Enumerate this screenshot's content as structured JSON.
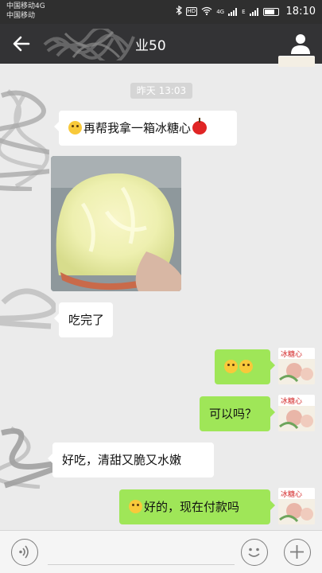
{
  "status_bar": {
    "carrier_line1": "中国移动4G",
    "carrier_line2": "中国移动",
    "network_1": "4G",
    "network_2": "E",
    "time": "18:10"
  },
  "header": {
    "title_suffix": "业50"
  },
  "chat": {
    "timestamp": "昨天 13:03",
    "messages": [
      {
        "side": "left",
        "text": "再帮我拿一箱冰糖心"
      },
      {
        "side": "left",
        "type": "image"
      },
      {
        "side": "left",
        "text": "吃完了"
      },
      {
        "side": "right",
        "text": ""
      },
      {
        "side": "right",
        "text": "可以吗？"
      },
      {
        "side": "left",
        "text": "好吃，清甜又脆又水嫩"
      },
      {
        "side": "right",
        "text": "好的，现在付款吗"
      }
    ]
  },
  "avatar_label": "冰糖心",
  "colors": {
    "header_bg": "#333335",
    "bubble_right": "#9fe658",
    "bubble_left": "#ffffff",
    "chat_bg": "#ebebeb"
  }
}
